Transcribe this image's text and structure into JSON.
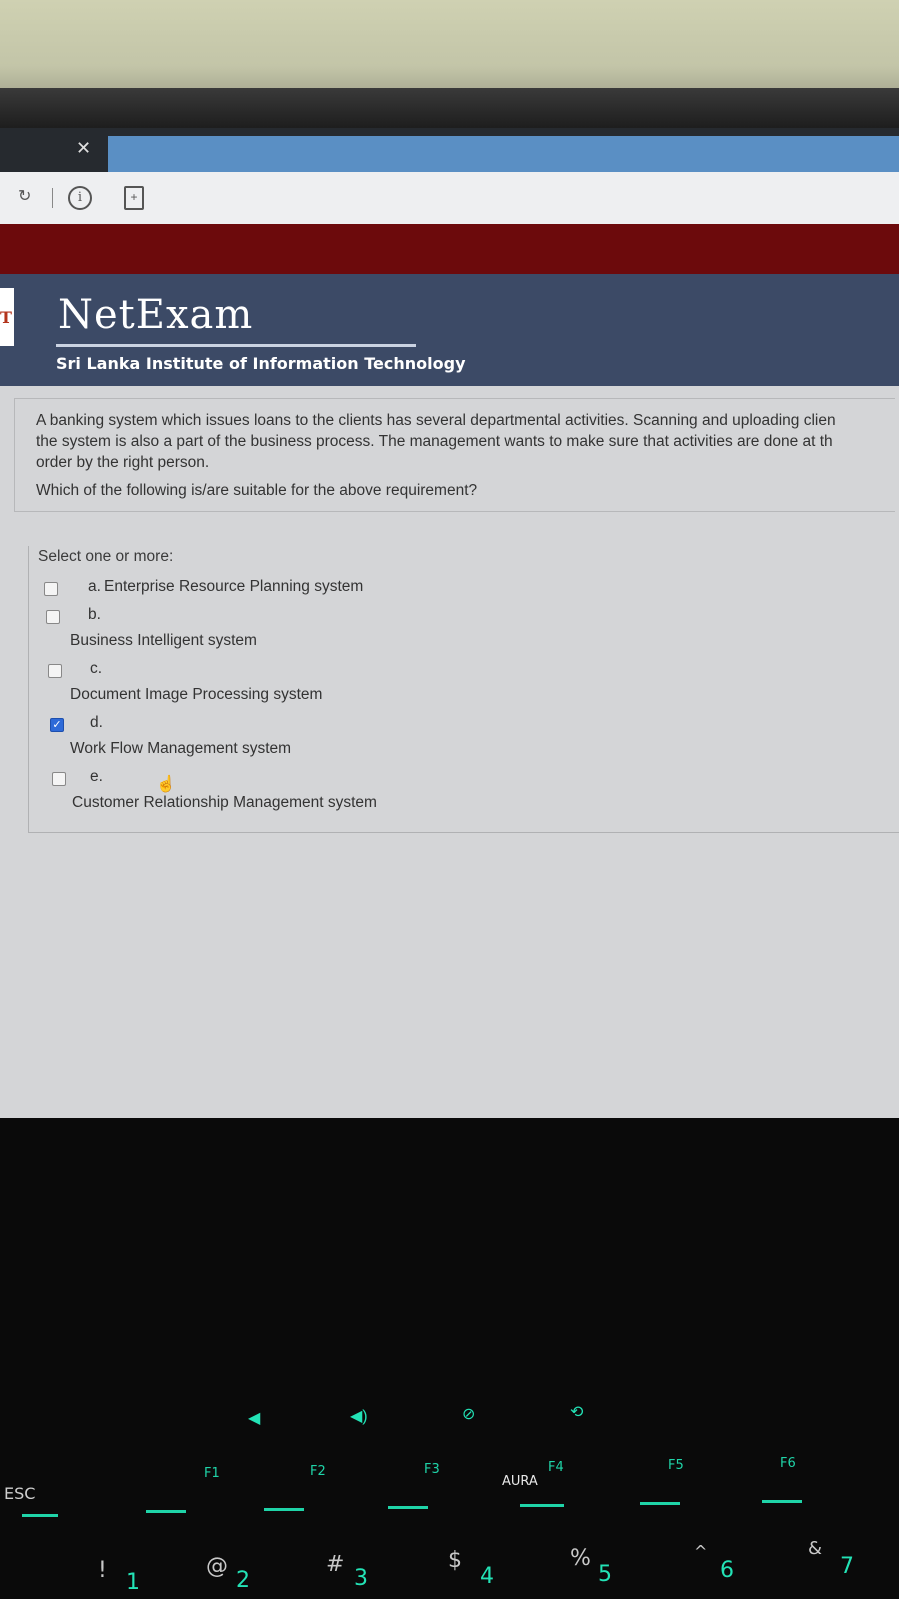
{
  "browser": {
    "tab_close_icon": "close-icon",
    "refresh_icon": "refresh-icon",
    "info_icon": "info-icon",
    "info_glyph": "i",
    "doc_icon": "add-document-icon",
    "doc_glyph": "+"
  },
  "header": {
    "logo_letter": "T",
    "brand": "NetExam",
    "institute": "Sri Lanka Institute of Information Technology"
  },
  "question": {
    "lines": [
      "A banking system which issues loans to the clients has several departmental activities. Scanning and uploading clien",
      "the system is also a part of the business process. The management wants to make sure that activities are done at th",
      "order by the right person."
    ],
    "ask": "Which of the following is/are suitable for the above requirement?"
  },
  "answers": {
    "prompt": "Select one or more:",
    "options": [
      {
        "letter": "a.",
        "label": "Enterprise Resource Planning system",
        "checked": false
      },
      {
        "letter": "b.",
        "label": "Business Intelligent system",
        "checked": false
      },
      {
        "letter": "c.",
        "label": "Document Image Processing system",
        "checked": false
      },
      {
        "letter": "d.",
        "label": "Work Flow Management system",
        "checked": true
      },
      {
        "letter": "e.",
        "label": "Customer Relationship Management system",
        "checked": false
      }
    ],
    "check_glyph": "✓"
  },
  "keyboard": {
    "esc": "ESC",
    "f1": "F1",
    "f2": "F2",
    "f3": "F3",
    "f4": "F4",
    "f5": "F5",
    "f6": "F6",
    "aura": "AURA",
    "row_symbols": [
      "!",
      "@",
      "#",
      "$",
      "%",
      "^",
      "&"
    ],
    "row_numbers": [
      "1",
      "2",
      "3",
      "4",
      "5",
      "6",
      "7"
    ]
  },
  "colors": {
    "header_bg": "#3c4a66",
    "accent_red": "#6c0a0c",
    "checkbox_checked": "#2e6ad8",
    "keyboard_glow": "#1fd4a8"
  }
}
